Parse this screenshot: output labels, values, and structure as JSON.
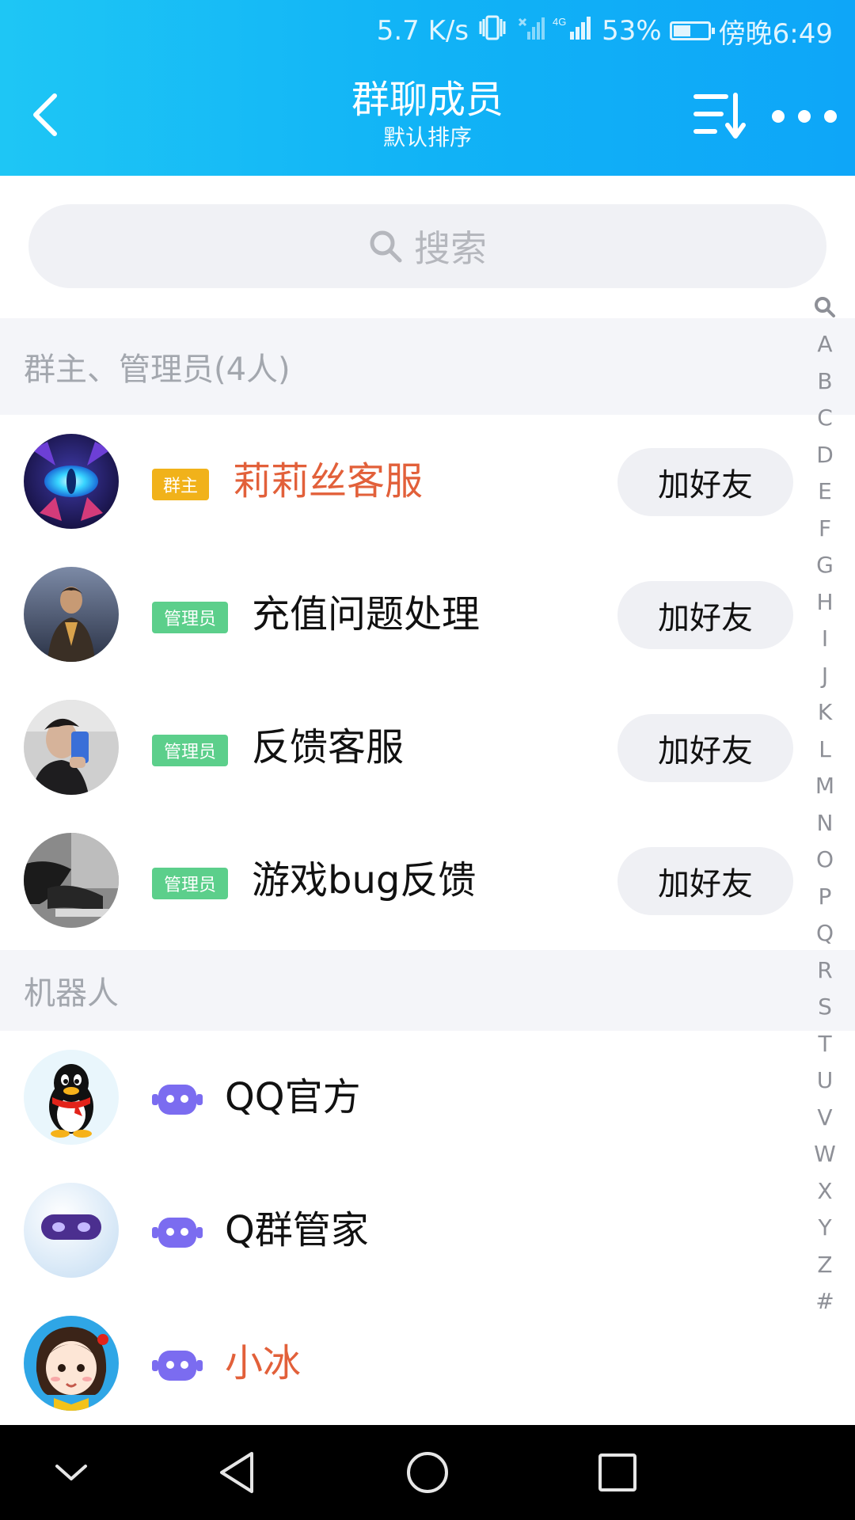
{
  "status_bar": {
    "speed": "5.7 K/s",
    "network": "4G",
    "battery_percent": "53%",
    "battery_level": 0.53,
    "time": "傍晚6:49",
    "icons": [
      "vibrate-icon",
      "no-sim-signal-icon",
      "signal-4g-icon",
      "battery-icon"
    ]
  },
  "header": {
    "title": "群聊成员",
    "subtitle": "默认排序",
    "icons": [
      "back-arrow-icon",
      "sort-icon",
      "more-icon"
    ],
    "colors": {
      "gradient_start": "#1ec6f5",
      "gradient_end": "#0ea6f8"
    }
  },
  "search": {
    "placeholder": "搜索",
    "icon": "search-icon"
  },
  "sections": {
    "admins": {
      "label": "群主、管理员(4人)",
      "members": [
        {
          "tag": "群主",
          "name": "莉莉丝客服",
          "action": "加好友",
          "avatar": "dark-creature-eye-avatar"
        },
        {
          "tag": "管理员",
          "name": "充值问题处理",
          "action": "加好友",
          "avatar": "person-photo-avatar"
        },
        {
          "tag": "管理员",
          "name": "反馈客服",
          "action": "加好友",
          "avatar": "selfie-photo-avatar"
        },
        {
          "tag": "管理员",
          "name": "游戏bug反馈",
          "action": "加好友",
          "avatar": "person-at-desk-avatar"
        }
      ]
    },
    "robots": {
      "label": "机器人",
      "members": [
        {
          "name": "QQ官方",
          "avatar": "qq-penguin-avatar",
          "badge": "robot-icon"
        },
        {
          "name": "Q群管家",
          "avatar": "robot-head-avatar",
          "badge": "robot-icon"
        },
        {
          "name": "小冰",
          "avatar": "cartoon-girl-avatar",
          "badge": "robot-icon"
        }
      ]
    }
  },
  "index_bar": [
    "A",
    "B",
    "C",
    "D",
    "E",
    "F",
    "G",
    "H",
    "I",
    "J",
    "K",
    "L",
    "M",
    "N",
    "O",
    "P",
    "Q",
    "R",
    "S",
    "T",
    "U",
    "V",
    "W",
    "X",
    "Y",
    "Z",
    "#"
  ],
  "colors": {
    "owner_tag": "#f1b21a",
    "admin_tag": "#5ccf8b",
    "highlight_name": "#e2603a",
    "robot_badge": "#7b6cf0"
  },
  "nav_bar": {
    "icons": [
      "hide-keyboard-icon",
      "back-icon",
      "home-icon",
      "recents-icon"
    ]
  }
}
